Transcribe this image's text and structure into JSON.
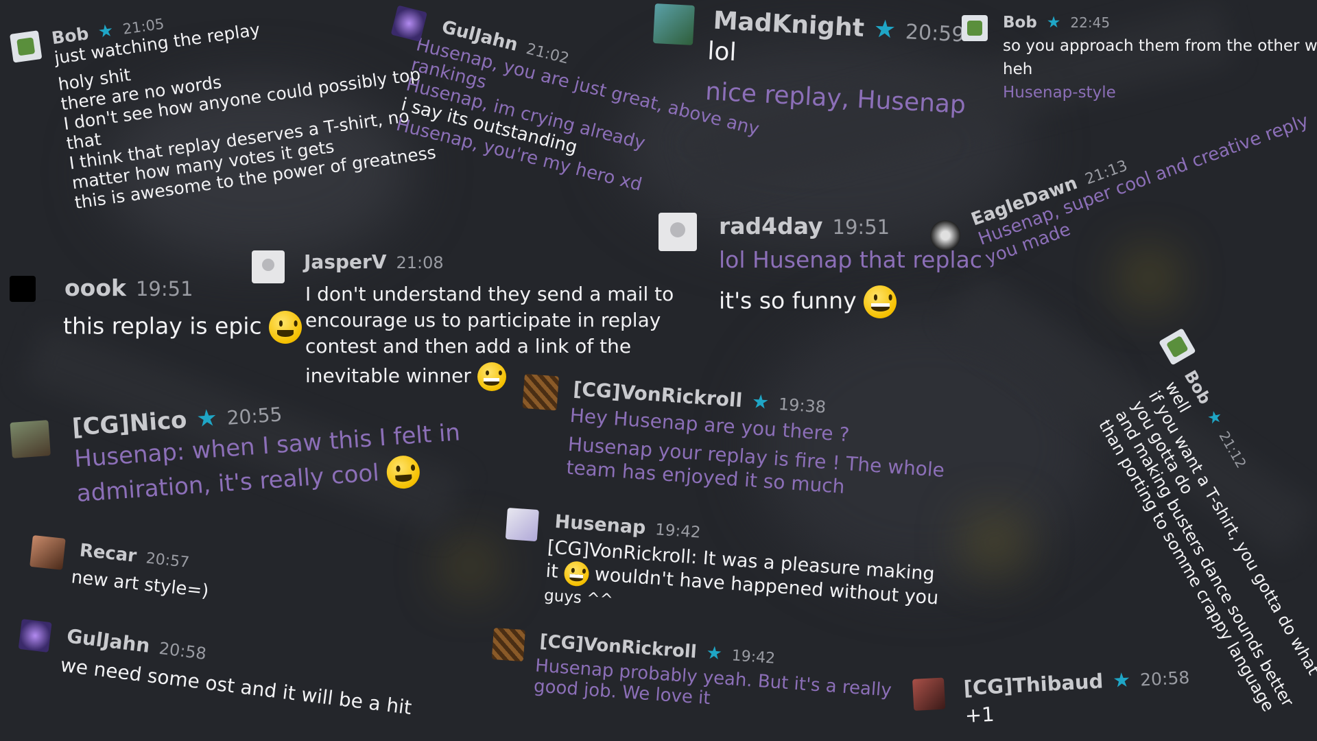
{
  "messages": {
    "m1": {
      "user": "Bob",
      "star": "★",
      "time": "21:05",
      "lines": [
        "just watching the replay",
        "holy shit",
        "there are no words",
        "I don't see how anyone could possibly top",
        "that",
        "I think that replay deserves a T-shirt, no",
        "matter how many votes it gets",
        "this is awesome to the power of greatness"
      ]
    },
    "m2": {
      "user": "GulJahn",
      "time": "21:02",
      "lines": [
        "Husenap, you are just great, above any",
        "rankings",
        "Husenap, im crying already",
        "i say its outstanding",
        "Husenap, you're my hero xd"
      ]
    },
    "m3": {
      "user": "MadKnight",
      "star": "★",
      "time": "20:59",
      "lines": [
        "lol",
        "nice replay, Husenap"
      ]
    },
    "m4": {
      "user": "Bob",
      "star": "★",
      "time": "22:45",
      "lines": [
        "so you approach them from the other way",
        "heh",
        "Husenap-style"
      ]
    },
    "m5": {
      "user": "EagleDawn",
      "time": "21:13",
      "lines": [
        "Husenap, super cool and creative reply",
        "you made"
      ]
    },
    "m6": {
      "user": "rad4day",
      "time": "19:51",
      "lines": [
        "lol Husenap that replac",
        "it's so funny"
      ]
    },
    "m7": {
      "user": "oook",
      "time": "19:51",
      "lines": [
        "this replay is epic"
      ]
    },
    "m8": {
      "user": "JasperV",
      "time": "21:08",
      "lines": [
        "I don't understand they send a mail to",
        "encourage us to participate in replay",
        "contest and then add a link of the",
        "inevitable winner"
      ]
    },
    "m9": {
      "user": "[CG]Nico",
      "star": "★",
      "time": "20:55",
      "lines": [
        "Husenap: when I saw this I felt in",
        "admiration, it's really cool"
      ]
    },
    "m10": {
      "user": "[CG]VonRickroll",
      "star": "★",
      "time": "19:38",
      "lines": [
        "Hey Husenap are you there ?",
        "Husenap your replay is fire ! The whole",
        "team has enjoyed it so much"
      ]
    },
    "m11": {
      "user": "Husenap",
      "time": "19:42",
      "lines": [
        "[CG]VonRickroll: It was a pleasure making",
        "it",
        "wouldn't have happened without you",
        "guys ^^"
      ]
    },
    "m12": {
      "user": "[CG]VonRickroll",
      "star": "★",
      "time": "19:42",
      "lines": [
        "Husenap probably yeah. But it's a really",
        "good job. We love it"
      ]
    },
    "m13": {
      "user": "Recar",
      "time": "20:57",
      "lines": [
        "new art style=)"
      ]
    },
    "m14": {
      "user": "GulJahn",
      "time": "20:58",
      "lines": [
        "we need some ost and it will be a hit"
      ]
    },
    "m15": {
      "user": "Bob",
      "star": "★",
      "time": "21:12",
      "lines": [
        "well",
        "if you want a T-shirt, you gotta do what",
        "you gotta do",
        "and making busters dance sounds better",
        "than porting to somme crappy language"
      ]
    },
    "m16": {
      "user": "[CG]Thibaud",
      "star": "★",
      "time": "20:58",
      "lines": [
        "+1"
      ]
    }
  },
  "colors": {
    "background": "#24262b",
    "mention": "#8c6fb8",
    "star": "#1fa6c6",
    "emoji": "#f5c000"
  }
}
